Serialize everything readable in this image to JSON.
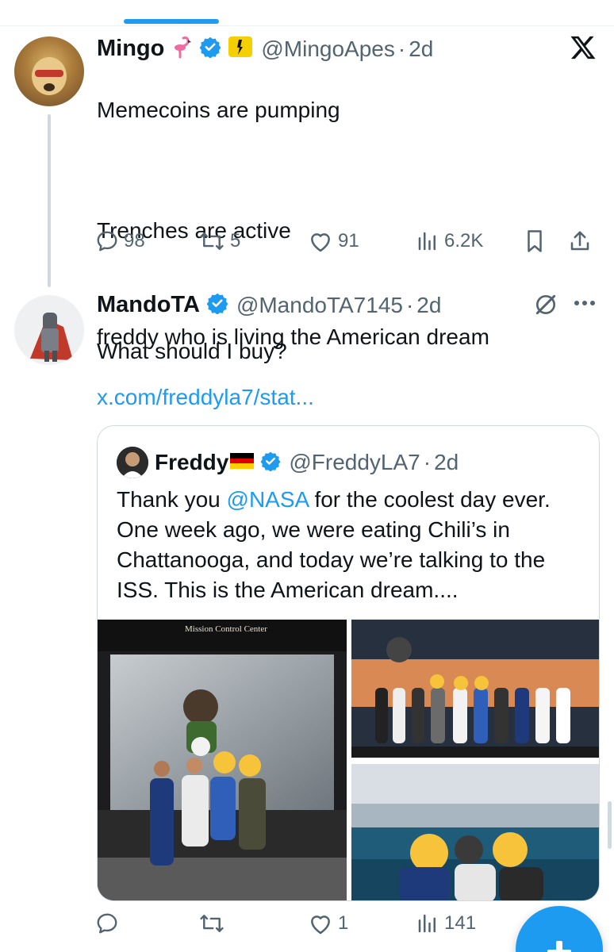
{
  "tweet1": {
    "name": "Mingo",
    "handle": "@MingoApes",
    "separator": "·",
    "time": "2d",
    "lines": [
      "Memecoins are pumping",
      "",
      "Trenches are active",
      "",
      "What should I buy?"
    ],
    "stats": {
      "replies": "98",
      "reposts": "5",
      "likes": "91",
      "views": "6.2K"
    },
    "badge_icons": [
      "flamingo-emoji",
      "verified-badge",
      "gold-affiliate-badge"
    ]
  },
  "tweet2": {
    "name": "MandoTA",
    "handle": "@MandoTA7145",
    "separator": "·",
    "time": "2d",
    "text": "freddy who is living the American dream",
    "link": "x.com/freddyla7/stat...",
    "quote": {
      "name": "Freddy",
      "handle": "@FreddyLA7",
      "separator": "·",
      "time": "2d",
      "text_before": "Thank you ",
      "mention": "@NASA",
      "text_after": " for the coolest day ever. One week ago, we were eating Chili’s in Chattanooga, and today we’re talking to the ISS. This is the American dream....",
      "images": [
        {
          "label": "Mission Control Center"
        },
        {
          "label": ""
        },
        {
          "label": ""
        }
      ]
    },
    "stats": {
      "replies": "",
      "reposts": "",
      "likes": "1",
      "views": "141"
    }
  },
  "colors": {
    "accent": "#1d9bf0",
    "text": "#0f1419",
    "muted": "#536471",
    "border": "#cfd9de"
  }
}
